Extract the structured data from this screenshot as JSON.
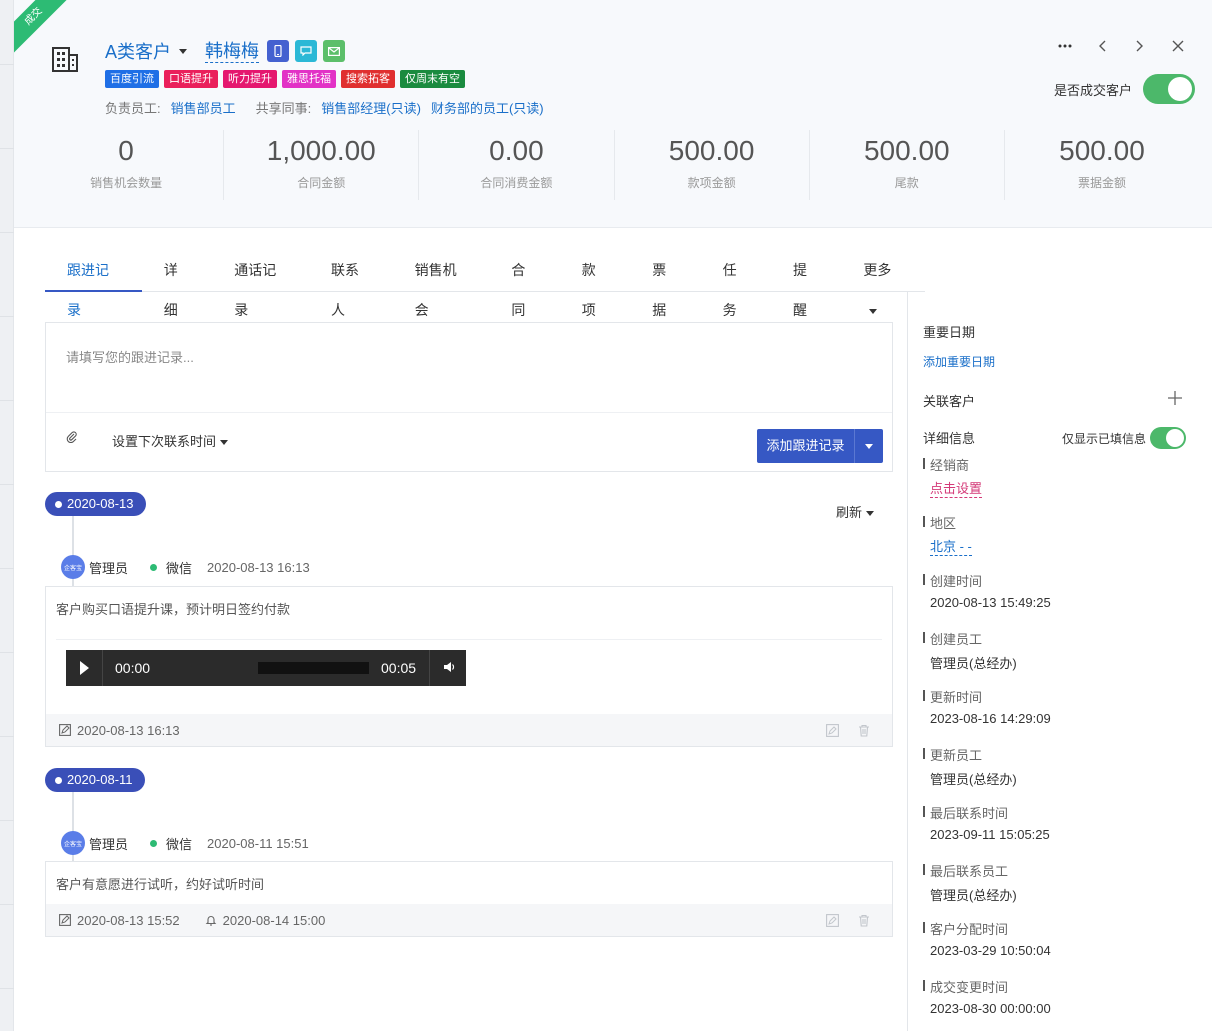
{
  "header": {
    "ribbon": "成交",
    "level": "A类客户",
    "name": "韩梅梅",
    "tags": [
      {
        "label": "百度引流",
        "color": "#1f6fe6"
      },
      {
        "label": "口语提升",
        "color": "#ea1f5b"
      },
      {
        "label": "听力提升",
        "color": "#e5176f"
      },
      {
        "label": "雅思托福",
        "color": "#e232c6"
      },
      {
        "label": "搜索拓客",
        "color": "#e02f2f"
      },
      {
        "label": "仅周末有空",
        "color": "#1a8b3f"
      }
    ],
    "staff_label": "负责员工:",
    "staff": "销售部员工",
    "share_label": "共享同事:",
    "share1": "销售部经理(只读)",
    "share2": "财务部的员工(只读)",
    "deal_label": "是否成交客户"
  },
  "stats": [
    {
      "value": "0",
      "label": "销售机会数量"
    },
    {
      "value": "1,000.00",
      "label": "合同金额"
    },
    {
      "value": "0.00",
      "label": "合同消费金额"
    },
    {
      "value": "500.00",
      "label": "款项金额"
    },
    {
      "value": "500.00",
      "label": "尾款"
    },
    {
      "value": "500.00",
      "label": "票据金额"
    }
  ],
  "tabs": [
    "跟进记录",
    "详细",
    "通话记录",
    "联系人",
    "销售机会",
    "合同",
    "款项",
    "票据",
    "任务",
    "提醒",
    "更多"
  ],
  "composer": {
    "placeholder": "请填写您的跟进记录...",
    "next_contact": "设置下次联系时间",
    "add_button": "添加跟进记录"
  },
  "refresh": "刷新",
  "records": [
    {
      "date": "2020-08-13",
      "user": "管理员",
      "avatar_text": "企客宝",
      "channel": "微信",
      "time": "2020-08-13 16:13",
      "content": "客户购买口语提升课，预计明日签约付款",
      "audio": {
        "current": "00:00",
        "duration": "00:05"
      },
      "footer_time": "2020-08-13 16:13"
    },
    {
      "date": "2020-08-11",
      "user": "管理员",
      "avatar_text": "企客宝",
      "channel": "微信",
      "time": "2020-08-11 15:51",
      "content": "客户有意愿进行试听，约好试听时间",
      "footer_time": "2020-08-13 15:52",
      "reminder_time": "2020-08-14 15:00"
    }
  ],
  "side": {
    "important_dates": "重要日期",
    "add_important_date": "添加重要日期",
    "related_customers": "关联客户",
    "detail_info": "详细信息",
    "only_filled": "仅显示已填信息",
    "fields": [
      {
        "label": "经销商",
        "value": "点击设置",
        "style": "pink"
      },
      {
        "label": "地区",
        "value": "北京 - -",
        "style": "blue"
      },
      {
        "label": "创建时间",
        "value": "2020-08-13 15:49:25",
        "style": ""
      },
      {
        "label": "创建员工",
        "value": "管理员(总经办)",
        "style": ""
      },
      {
        "label": "更新时间",
        "value": "2023-08-16 14:29:09",
        "style": ""
      },
      {
        "label": "更新员工",
        "value": "管理员(总经办)",
        "style": ""
      },
      {
        "label": "最后联系时间",
        "value": "2023-09-11 15:05:25",
        "style": ""
      },
      {
        "label": "最后联系员工",
        "value": "管理员(总经办)",
        "style": ""
      },
      {
        "label": "客户分配时间",
        "value": "2023-03-29 10:50:04",
        "style": ""
      },
      {
        "label": "成交变更时间",
        "value": "2023-08-30 00:00:00",
        "style": ""
      }
    ]
  },
  "colors": {
    "primary": "#3658c4",
    "link": "#1a6fc9",
    "success": "#2dbb74",
    "toggle_on": "#4cb86a"
  }
}
